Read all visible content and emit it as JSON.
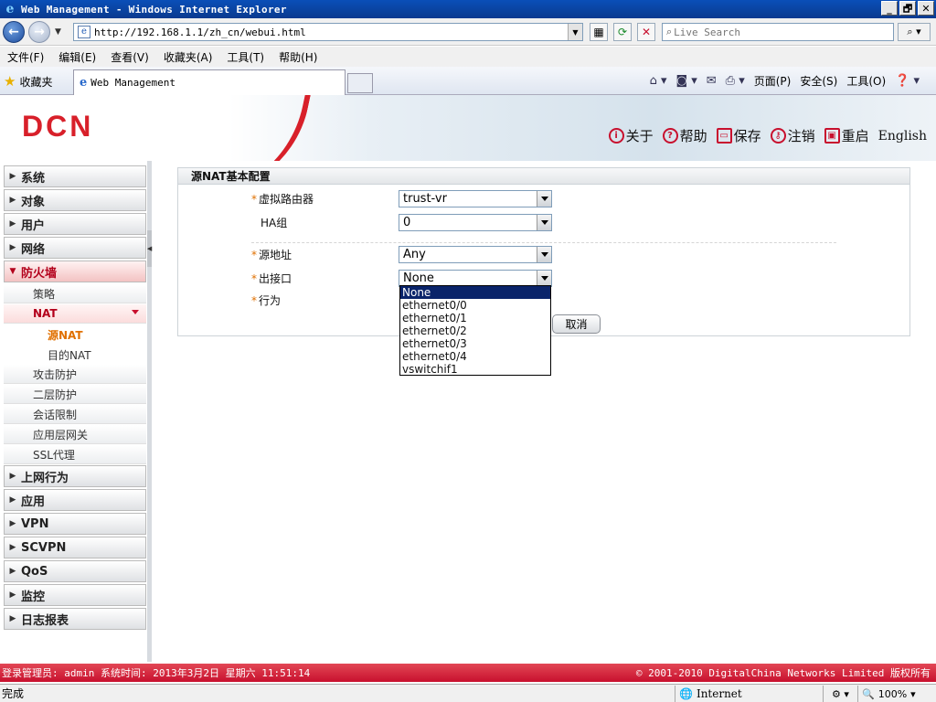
{
  "window": {
    "title": "Web Management - Windows Internet Explorer",
    "minimize": "_",
    "restore": "🗗",
    "close": "✕"
  },
  "browser": {
    "url": "http://192.168.1.1/zh_cn/webui.html",
    "search_placeholder": "Live Search",
    "menu": [
      "文件(F)",
      "编辑(E)",
      "查看(V)",
      "收藏夹(A)",
      "工具(T)",
      "帮助(H)"
    ],
    "favorites_label": "收藏夹",
    "tab_label": "Web Management",
    "cmd": {
      "page": "页面(P)",
      "safety": "安全(S)",
      "tools": "工具(O)"
    },
    "status_done": "完成",
    "zone": "Internet",
    "zoom": "100%"
  },
  "header": {
    "logo": "DCN",
    "links": {
      "about": "关于",
      "help": "帮助",
      "save": "保存",
      "logout": "注销",
      "reboot": "重启",
      "english": "English"
    }
  },
  "sidebar": {
    "items": [
      {
        "label": "系统"
      },
      {
        "label": "对象"
      },
      {
        "label": "用户"
      },
      {
        "label": "网络"
      },
      {
        "label": "防火墙"
      }
    ],
    "firewall_sub": [
      {
        "label": "策略"
      },
      {
        "label": "NAT"
      }
    ],
    "nat_sub": [
      {
        "label": "源NAT"
      },
      {
        "label": "目的NAT"
      }
    ],
    "firewall_sub2": [
      {
        "label": "攻击防护"
      },
      {
        "label": "二层防护"
      },
      {
        "label": "会话限制"
      },
      {
        "label": "应用层网关"
      },
      {
        "label": "SSL代理"
      }
    ],
    "items2": [
      {
        "label": "上网行为"
      },
      {
        "label": "应用"
      },
      {
        "label": "VPN"
      },
      {
        "label": "SCVPN"
      },
      {
        "label": "QoS"
      },
      {
        "label": "监控"
      },
      {
        "label": "日志报表"
      }
    ]
  },
  "form": {
    "title": "源NAT基本配置",
    "virtual_router_label": "虚拟路由器",
    "virtual_router_value": "trust-vr",
    "ha_label": "HA组",
    "ha_value": "0",
    "src_addr_label": "源地址",
    "src_addr_value": "Any",
    "egress_label": "出接口",
    "egress_value": "None",
    "action_label": "行为",
    "cancel_label": "取消",
    "egress_options": [
      "None",
      "ethernet0/0",
      "ethernet0/1",
      "ethernet0/2",
      "ethernet0/3",
      "ethernet0/4",
      "vswitchif1"
    ]
  },
  "footer": {
    "left": "登录管理员: admin 系统时间: 2013年3月2日 星期六 11:51:14",
    "right": "© 2001-2010 DigitalChina Networks Limited 版权所有"
  },
  "colors": {
    "brand_red": "#d8202a",
    "selection_blue": "#0a246a",
    "required_orange": "#e07000"
  }
}
